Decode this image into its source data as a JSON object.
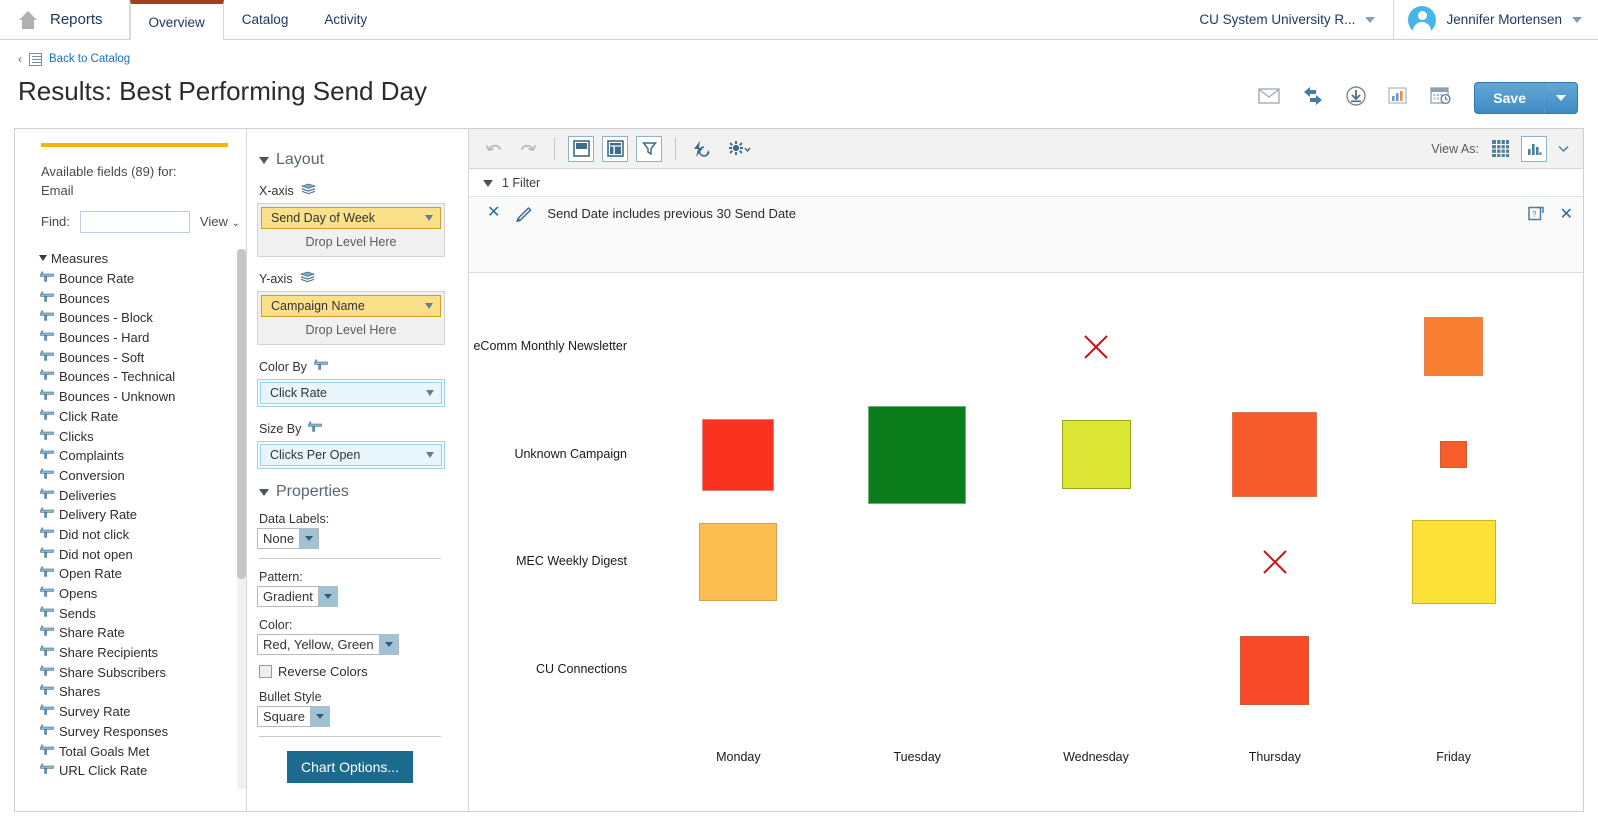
{
  "topnav": {
    "brand": "Reports",
    "home_icon": "home-icon",
    "tabs": [
      {
        "label": "Overview",
        "active": true
      },
      {
        "label": "Catalog",
        "active": false
      },
      {
        "label": "Activity",
        "active": false
      }
    ],
    "org": "CU System University R...",
    "user": "Jennifer Mortensen"
  },
  "breadcrumb": {
    "chevron": "‹",
    "link": "Back to Catalog"
  },
  "page": {
    "title": "Results: Best Performing Send Day"
  },
  "titletools": {
    "icons": [
      "email-icon",
      "share-icon",
      "download-icon",
      "chart-icon",
      "schedule-icon"
    ],
    "save_label": "Save"
  },
  "fields": {
    "available_line1": "Available fields (89) for:",
    "available_line2": "Email",
    "find_label": "Find:",
    "find_value": "",
    "find_placeholder": "",
    "view_label": "View",
    "group_label": "Measures",
    "items": [
      "Bounce Rate",
      "Bounces",
      "Bounces - Block",
      "Bounces - Hard",
      "Bounces - Soft",
      "Bounces - Technical",
      "Bounces - Unknown",
      "Click Rate",
      "Clicks",
      "Complaints",
      "Conversion",
      "Deliveries",
      "Delivery Rate",
      "Did not click",
      "Did not open",
      "Open Rate",
      "Opens",
      "Sends",
      "Share Rate",
      "Share Recipients",
      "Share Subscribers",
      "Shares",
      "Survey Rate",
      "Survey Responses",
      "Total Goals Met",
      "URL Click Rate"
    ]
  },
  "layout": {
    "section_title": "Layout",
    "xaxis_label": "X-axis",
    "xaxis_value": "Send Day of Week",
    "xaxis_drop": "Drop Level Here",
    "yaxis_label": "Y-axis",
    "yaxis_value": "Campaign Name",
    "yaxis_drop": "Drop Level Here",
    "colorby_label": "Color By",
    "colorby_value": "Click Rate",
    "sizeby_label": "Size By",
    "sizeby_value": "Clicks Per Open"
  },
  "properties": {
    "section_title": "Properties",
    "data_labels_label": "Data Labels:",
    "data_labels_value": "None",
    "pattern_label": "Pattern:",
    "pattern_value": "Gradient",
    "color_label": "Color:",
    "color_value": "Red, Yellow, Green",
    "reverse_colors_label": "Reverse Colors",
    "reverse_colors_checked": false,
    "bullet_style_label": "Bullet Style",
    "bullet_style_value": "Square",
    "chart_options_label": "Chart Options..."
  },
  "charttoolbar": {
    "undo_icon": "undo-icon",
    "redo_icon": "redo-icon",
    "panel_icon": "panel-layout-icon",
    "columns_icon": "columns-layout-icon",
    "filter_icon": "filter-funnel-icon",
    "refresh_icon": "auto-refresh-icon",
    "settings_icon": "gear-icon",
    "viewas_label": "View As:",
    "grid_icon": "grid-view-icon",
    "chart_icon": "chart-view-icon"
  },
  "filter": {
    "header": "1 Filter",
    "remove_icon": "close-icon",
    "edit_icon": "pencil-icon",
    "text": "Send Date includes previous 30 Send Date",
    "help_icon": "help-box-icon",
    "close_icon": "close-icon"
  },
  "chart_data": {
    "type": "heatmap",
    "title": "Results: Best Performing Send Day",
    "xlabel": "Send Day of Week",
    "ylabel": "Campaign Name",
    "color_by": "Click Rate",
    "size_by": "Clicks Per Open",
    "color_scheme": "Red, Yellow, Green",
    "categories_x": [
      "Monday",
      "Tuesday",
      "Wednesday",
      "Thursday",
      "Friday"
    ],
    "categories_y": [
      "eComm Monthly Newsletter",
      "Unknown Campaign",
      "MEC Weekly Digest",
      "CU Connections"
    ],
    "grid": false,
    "legend": "none",
    "points": [
      {
        "x": "Wednesday",
        "y": "eComm Monthly Newsletter",
        "null": true,
        "size": 0,
        "color": "#c81414"
      },
      {
        "x": "Friday",
        "y": "eComm Monthly Newsletter",
        "null": false,
        "size": 59,
        "color": "#f98032",
        "border": "#e28552"
      },
      {
        "x": "Monday",
        "y": "Unknown Campaign",
        "null": false,
        "size": 72,
        "color": "#fa3220",
        "border": "#e28080"
      },
      {
        "x": "Tuesday",
        "y": "Unknown Campaign",
        "null": false,
        "size": 98,
        "color": "#0b7d1b",
        "border": "#6fae74"
      },
      {
        "x": "Wednesday",
        "y": "Unknown Campaign",
        "null": false,
        "size": 69,
        "color": "#dbe734",
        "border": "#9aa520"
      },
      {
        "x": "Thursday",
        "y": "Unknown Campaign",
        "null": false,
        "size": 85,
        "color": "#f75a2c",
        "border": "#d07a4f"
      },
      {
        "x": "Friday",
        "y": "Unknown Campaign",
        "null": false,
        "size": 27,
        "color": "#f85c2a",
        "border": "#c95e32"
      },
      {
        "x": "Monday",
        "y": "MEC Weekly Digest",
        "null": false,
        "size": 78,
        "color": "#fbbe50",
        "border": "#d2a24d"
      },
      {
        "x": "Thursday",
        "y": "MEC Weekly Digest",
        "null": true,
        "size": 0,
        "color": "#c81414"
      },
      {
        "x": "Friday",
        "y": "MEC Weekly Digest",
        "null": false,
        "size": 84,
        "color": "#fde137",
        "border": "#c9b328"
      },
      {
        "x": "Thursday",
        "y": "CU Connections",
        "null": false,
        "size": 69,
        "color": "#f8492a",
        "border": "#cc5a3c"
      }
    ]
  }
}
